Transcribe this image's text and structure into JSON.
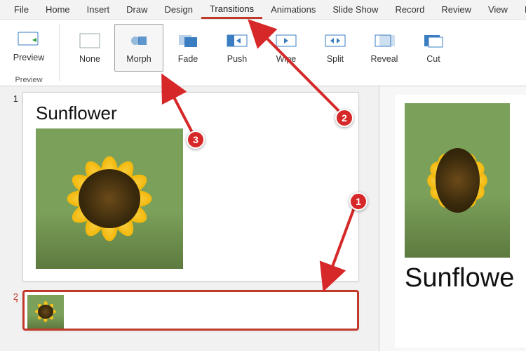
{
  "menu": {
    "tabs": [
      "File",
      "Home",
      "Insert",
      "Draw",
      "Design",
      "Transitions",
      "Animations",
      "Slide Show",
      "Record",
      "Review",
      "View",
      "Develo"
    ],
    "activeIndex": 5
  },
  "ribbon": {
    "previewGroup": {
      "item": "Preview",
      "label": "Preview"
    },
    "transitions": [
      {
        "label": "None"
      },
      {
        "label": "Morph",
        "selected": true
      },
      {
        "label": "Fade"
      },
      {
        "label": "Push"
      },
      {
        "label": "Wipe"
      },
      {
        "label": "Split"
      },
      {
        "label": "Reveal"
      },
      {
        "label": "Cut"
      }
    ]
  },
  "thumbs": {
    "slide1": {
      "num": "1",
      "title": "Sunflower"
    },
    "slide2": {
      "num": "2",
      "marker": "*",
      "selected": true
    }
  },
  "main": {
    "title": "Sunflowe"
  },
  "annotations": {
    "b1": "1",
    "b2": "2",
    "b3": "3"
  }
}
